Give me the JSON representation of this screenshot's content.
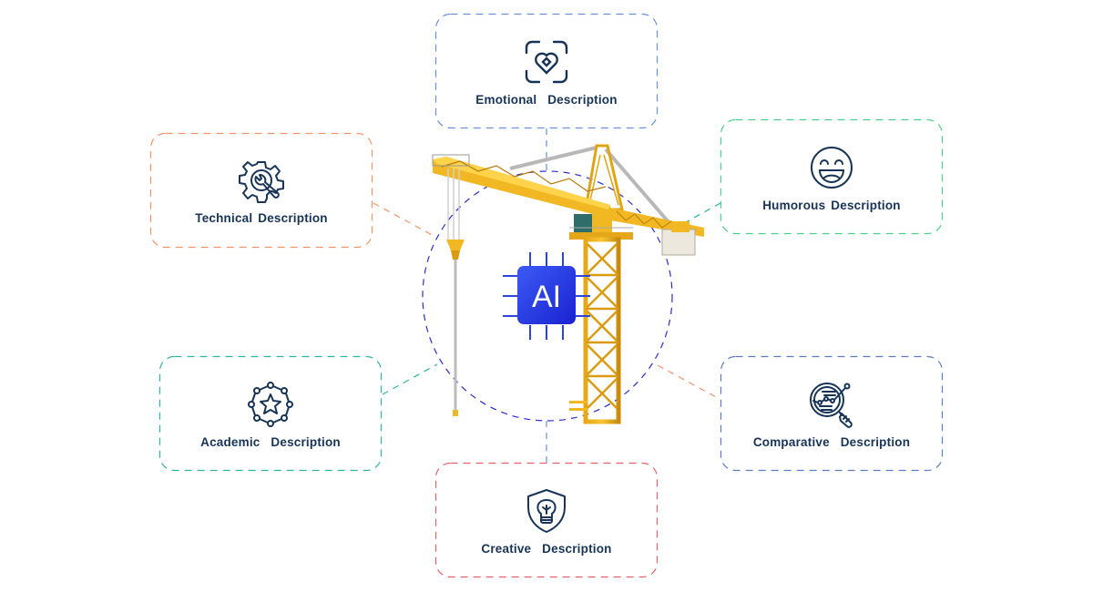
{
  "diagram": {
    "center": {
      "chip_label": "AI",
      "image": "tower-crane",
      "colors": {
        "chip_start": "#3B5BF5",
        "chip_end": "#1A22D0",
        "circle_stroke": "#2B2FC7"
      }
    },
    "cards": [
      {
        "id": "emotional",
        "label": "Emotional  Description",
        "icon": "heart-scan-icon",
        "border_color": "#6A8FE0"
      },
      {
        "id": "technical",
        "label": "Technical Description",
        "icon": "gear-wrench-icon",
        "border_color": "#F0956A"
      },
      {
        "id": "humorous",
        "label": "Humorous Description",
        "icon": "laughing-face-icon",
        "border_color": "#4CD08A"
      },
      {
        "id": "academic",
        "label": "Academic  Description",
        "icon": "star-network-icon",
        "border_color": "#2FB59E"
      },
      {
        "id": "comparative",
        "label": "Comparative  Description",
        "icon": "magnifier-chart-icon",
        "border_color": "#5A7CC8"
      },
      {
        "id": "creative",
        "label": "Creative  Description",
        "icon": "shield-bulb-icon",
        "border_color": "#E0636A"
      }
    ],
    "text_color": "#173457"
  }
}
